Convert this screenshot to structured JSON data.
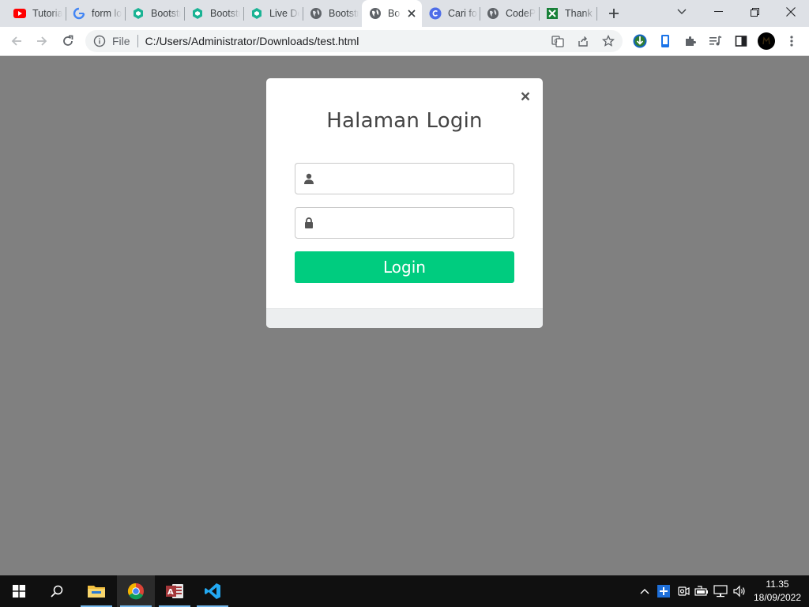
{
  "browser": {
    "tabs": [
      {
        "label": "Tutorial",
        "icon": "youtube-icon"
      },
      {
        "label": "form login",
        "icon": "google-icon"
      },
      {
        "label": "Bootstrap",
        "icon": "bootsnipp-icon"
      },
      {
        "label": "Bootstrap",
        "icon": "bootsnipp-icon"
      },
      {
        "label": "Live Demo",
        "icon": "bootsnipp-icon"
      },
      {
        "label": "Bootstrap",
        "icon": "globe-icon"
      },
      {
        "label": "Bootstrap",
        "icon": "globe-icon",
        "active": true
      },
      {
        "label": "Cari font",
        "icon": "canva-icon"
      },
      {
        "label": "CodePen",
        "icon": "globe-icon"
      },
      {
        "label": "Thank you",
        "icon": "sheets-icon"
      }
    ],
    "address": {
      "scheme_label": "File",
      "url": "C:/Users/Administrator/Downloads/test.html"
    }
  },
  "modal": {
    "title": "Halaman Login",
    "close_label": "×",
    "username": {
      "value": "",
      "placeholder": ""
    },
    "password": {
      "value": "",
      "placeholder": ""
    },
    "login_label": "Login"
  },
  "taskbar": {
    "time": "11.35",
    "date": "18/09/2022"
  },
  "colors": {
    "backdrop": "#808080",
    "login_button": "#00cc7f",
    "modal_footer": "#eceeef"
  }
}
